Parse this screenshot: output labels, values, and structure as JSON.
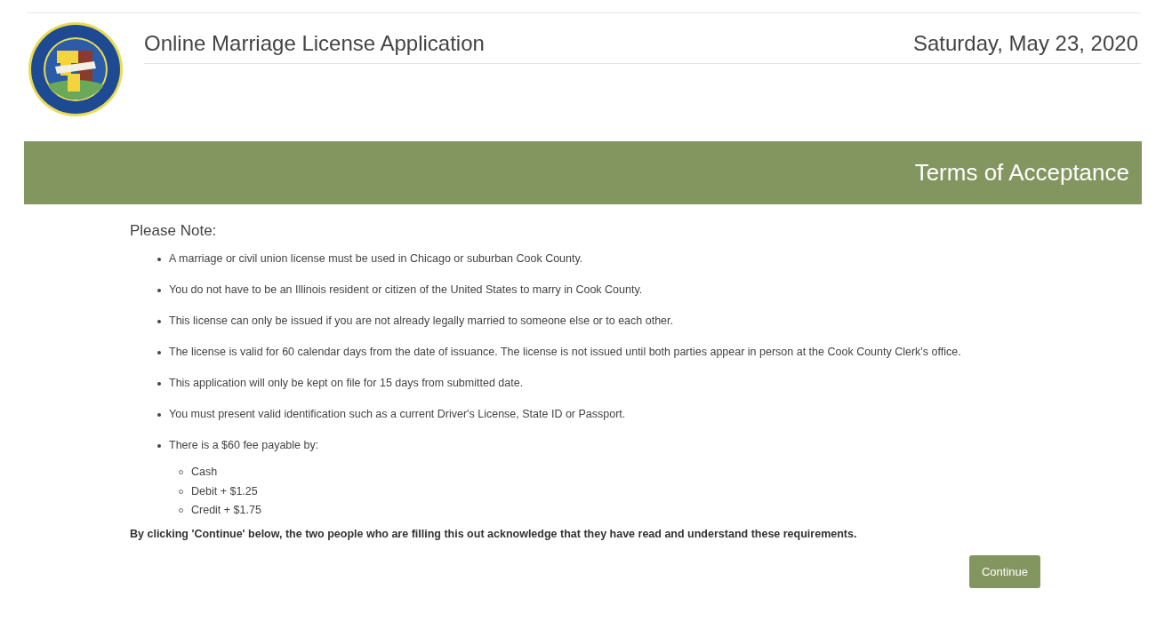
{
  "header": {
    "title": "Online Marriage License Application",
    "date": "Saturday, May 23, 2020"
  },
  "banner": {
    "title": "Terms of Acceptance"
  },
  "notes": {
    "heading": "Please Note:",
    "items": [
      {
        "text": "A marriage or civil union license must be used in Chicago or suburban Cook County."
      },
      {
        "text": "You do not have to be an Illinois resident or citizen of the United States to marry in Cook County."
      },
      {
        "text": "This license can only be issued if you are not already legally married to someone else or to each other."
      },
      {
        "text": "The license is valid for 60 calendar days from the date of issuance. The license is not issued until both parties appear in person at the Cook County Clerk's office."
      },
      {
        "text": "This application will only be kept on file for 15 days from submitted date."
      },
      {
        "text": "You must present valid identification such as a current Driver's License, State ID or Passport."
      },
      {
        "text": "There is a $60 fee payable by:",
        "children": [
          {
            "text": "Cash"
          },
          {
            "text": "Debit + $1.25"
          },
          {
            "text": "Credit + $1.75"
          }
        ]
      }
    ],
    "acknowledgement": "By clicking 'Continue' below, the two people who are filling this out acknowledge that they have read and understand these requirements."
  },
  "buttons": [
    {
      "label": "Continue"
    }
  ]
}
